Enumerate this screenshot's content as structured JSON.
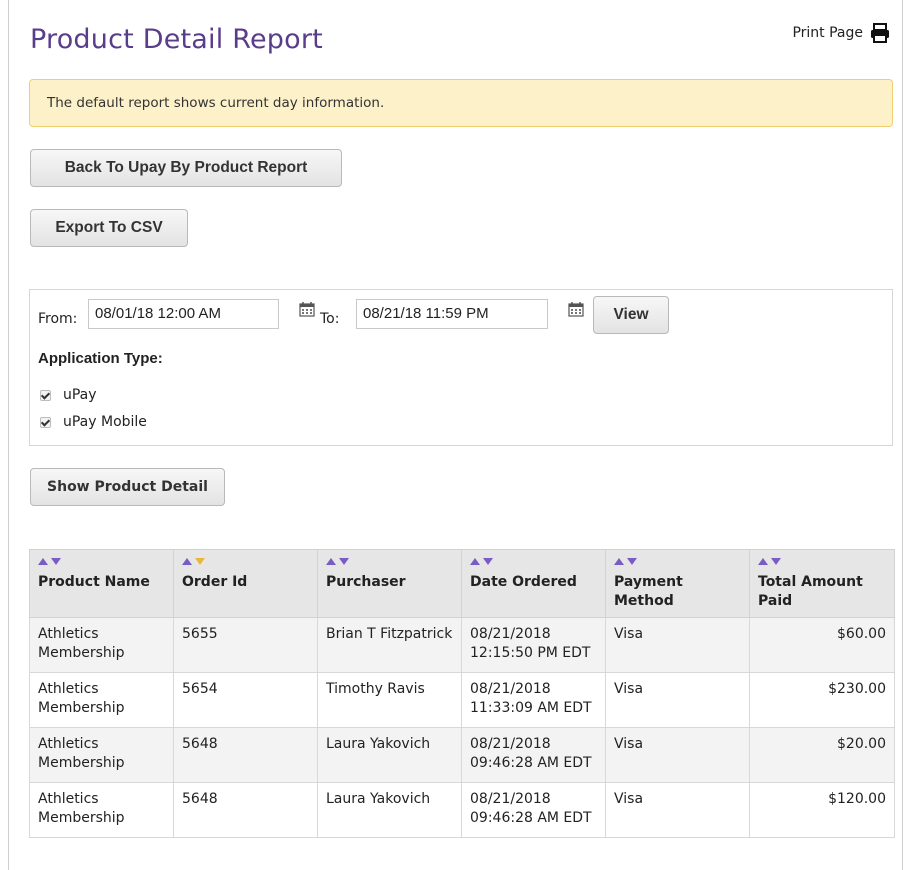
{
  "page": {
    "title": "Product Detail Report",
    "print_label": "Print Page",
    "alert_text": "The default report shows current day information."
  },
  "buttons": {
    "back": "Back To Upay By Product Report",
    "export": "Export To CSV",
    "view": "View",
    "show_detail": "Show Product Detail"
  },
  "filter": {
    "from_label": "From:",
    "from_value": "08/01/18 12:00 AM",
    "to_label": "To:",
    "to_value": "08/21/18 11:59 PM",
    "app_type_label": "Application Type:",
    "options": [
      {
        "label": "uPay",
        "checked": true
      },
      {
        "label": "uPay Mobile",
        "checked": true
      }
    ]
  },
  "table": {
    "columns": [
      "Product Name",
      "Order Id",
      "Purchaser",
      "Date Ordered",
      "Payment Method",
      "Total Amount Paid"
    ],
    "sorted_column": "Order Id",
    "sort_direction": "descending",
    "rows": [
      {
        "product": "Athletics Membership",
        "order_id": "5655",
        "purchaser": "Brian T Fitzpatrick",
        "date": "08/21/2018 12:15:50 PM EDT",
        "payment": "Visa",
        "amount": "$60.00"
      },
      {
        "product": "Athletics Membership",
        "order_id": "5654",
        "purchaser": "Timothy Ravis",
        "date": "08/21/2018 11:33:09 AM EDT",
        "payment": "Visa",
        "amount": "$230.00"
      },
      {
        "product": "Athletics Membership",
        "order_id": "5648",
        "purchaser": "Laura Yakovich",
        "date": "08/21/2018 09:46:28 AM EDT",
        "payment": "Visa",
        "amount": "$20.00"
      },
      {
        "product": "Athletics Membership",
        "order_id": "5648",
        "purchaser": "Laura Yakovich",
        "date": "08/21/2018 09:46:28 AM EDT",
        "payment": "Visa",
        "amount": "$120.00"
      }
    ]
  },
  "colors": {
    "title": "#5a3d8a",
    "alert_bg": "#fcf1c9",
    "alert_border": "#f0cf6e",
    "sort_arrow": "#7a5cc4",
    "sort_active": "#e8b83c"
  },
  "icons": {
    "print": "printer-icon",
    "calendar": "calendar-icon"
  }
}
